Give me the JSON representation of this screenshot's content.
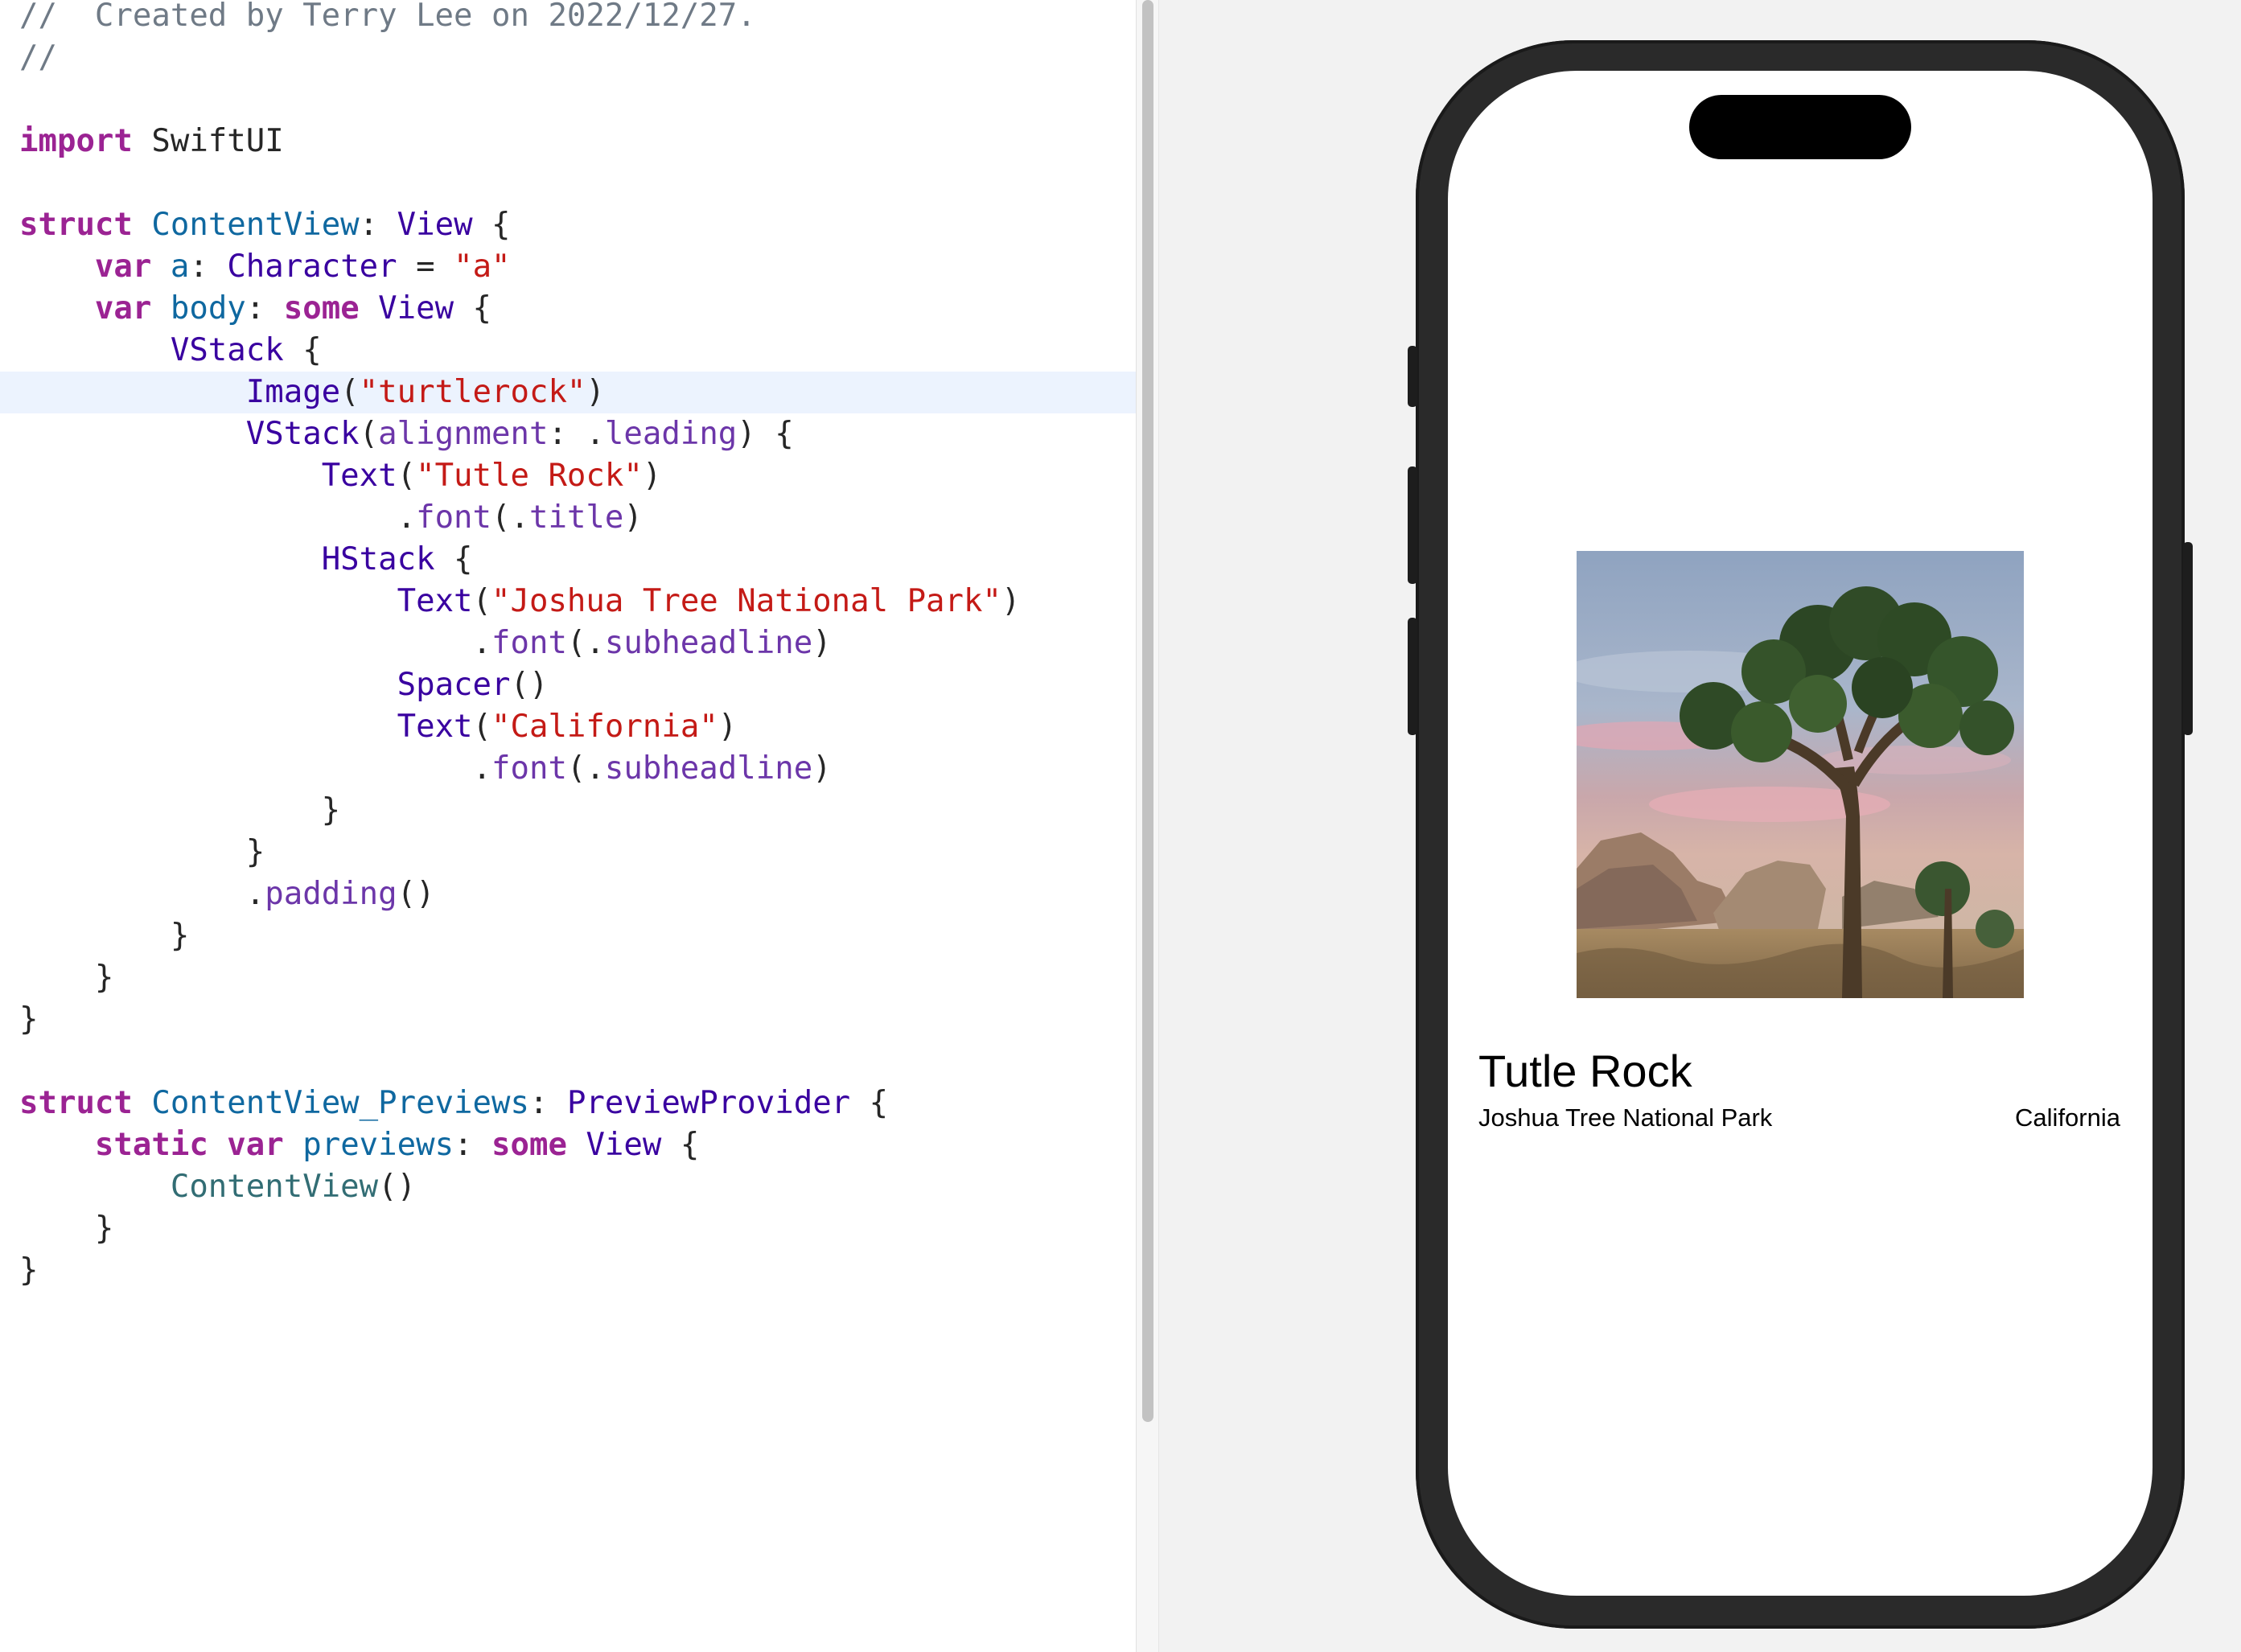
{
  "editor": {
    "lines": [
      [
        [
          "comment",
          "//  Created by Terry Lee on 2022/12/27."
        ]
      ],
      [
        [
          "comment",
          "//"
        ]
      ],
      [],
      [
        [
          "keyword",
          "import"
        ],
        [
          "plain",
          " SwiftUI"
        ]
      ],
      [],
      [
        [
          "keyword",
          "struct"
        ],
        [
          "plain",
          " "
        ],
        [
          "typedecl",
          "ContentView"
        ],
        [
          "plain",
          ": "
        ],
        [
          "type",
          "View"
        ],
        [
          "plain",
          " {"
        ]
      ],
      [
        [
          "plain",
          "    "
        ],
        [
          "keyword",
          "var"
        ],
        [
          "plain",
          " "
        ],
        [
          "typedecl",
          "a"
        ],
        [
          "plain",
          ": "
        ],
        [
          "type",
          "Character"
        ],
        [
          "plain",
          " = "
        ],
        [
          "string",
          "\"a\""
        ]
      ],
      [
        [
          "plain",
          "    "
        ],
        [
          "keyword",
          "var"
        ],
        [
          "plain",
          " "
        ],
        [
          "typedecl",
          "body"
        ],
        [
          "plain",
          ": "
        ],
        [
          "keyword",
          "some"
        ],
        [
          "plain",
          " "
        ],
        [
          "type",
          "View"
        ],
        [
          "plain",
          " {"
        ]
      ],
      [
        [
          "plain",
          "        "
        ],
        [
          "type",
          "VStack"
        ],
        [
          "plain",
          " {"
        ]
      ],
      [
        [
          "plain",
          "            "
        ],
        [
          "type",
          "Image"
        ],
        [
          "plain",
          "("
        ],
        [
          "string",
          "\"turtlerock\""
        ],
        [
          "plain",
          ")"
        ]
      ],
      [
        [
          "plain",
          "            "
        ],
        [
          "type",
          "VStack"
        ],
        [
          "plain",
          "("
        ],
        [
          "member",
          "alignment"
        ],
        [
          "plain",
          ": ."
        ],
        [
          "member",
          "leading"
        ],
        [
          "plain",
          ") {"
        ]
      ],
      [
        [
          "plain",
          "                "
        ],
        [
          "type",
          "Text"
        ],
        [
          "plain",
          "("
        ],
        [
          "string",
          "\"Tutle Rock\""
        ],
        [
          "plain",
          ")"
        ]
      ],
      [
        [
          "plain",
          "                    ."
        ],
        [
          "member",
          "font"
        ],
        [
          "plain",
          "(."
        ],
        [
          "member",
          "title"
        ],
        [
          "plain",
          ")"
        ]
      ],
      [
        [
          "plain",
          "                "
        ],
        [
          "type",
          "HStack"
        ],
        [
          "plain",
          " {"
        ]
      ],
      [
        [
          "plain",
          "                    "
        ],
        [
          "type",
          "Text"
        ],
        [
          "plain",
          "("
        ],
        [
          "string",
          "\"Joshua Tree National Park\""
        ],
        [
          "plain",
          ")"
        ]
      ],
      [
        [
          "plain",
          "                        ."
        ],
        [
          "member",
          "font"
        ],
        [
          "plain",
          "(."
        ],
        [
          "member",
          "subheadline"
        ],
        [
          "plain",
          ")"
        ]
      ],
      [
        [
          "plain",
          "                    "
        ],
        [
          "type",
          "Spacer"
        ],
        [
          "plain",
          "()"
        ]
      ],
      [
        [
          "plain",
          "                    "
        ],
        [
          "type",
          "Text"
        ],
        [
          "plain",
          "("
        ],
        [
          "string",
          "\"California\""
        ],
        [
          "plain",
          ")"
        ]
      ],
      [
        [
          "plain",
          "                        ."
        ],
        [
          "member",
          "font"
        ],
        [
          "plain",
          "(."
        ],
        [
          "member",
          "subheadline"
        ],
        [
          "plain",
          ")"
        ]
      ],
      [
        [
          "plain",
          "                }"
        ]
      ],
      [
        [
          "plain",
          "            }"
        ]
      ],
      [
        [
          "plain",
          "            ."
        ],
        [
          "member",
          "padding"
        ],
        [
          "plain",
          "()"
        ]
      ],
      [
        [
          "plain",
          "        }"
        ]
      ],
      [
        [
          "plain",
          "    }"
        ]
      ],
      [
        [
          "plain",
          "}"
        ]
      ],
      [],
      [
        [
          "keyword",
          "struct"
        ],
        [
          "plain",
          " "
        ],
        [
          "typedecl",
          "ContentView_Previews"
        ],
        [
          "plain",
          ": "
        ],
        [
          "type",
          "PreviewProvider"
        ],
        [
          "plain",
          " {"
        ]
      ],
      [
        [
          "plain",
          "    "
        ],
        [
          "keyword",
          "static"
        ],
        [
          "plain",
          " "
        ],
        [
          "keyword",
          "var"
        ],
        [
          "plain",
          " "
        ],
        [
          "typedecl",
          "previews"
        ],
        [
          "plain",
          ": "
        ],
        [
          "keyword",
          "some"
        ],
        [
          "plain",
          " "
        ],
        [
          "type",
          "View"
        ],
        [
          "plain",
          " {"
        ]
      ],
      [
        [
          "plain",
          "        "
        ],
        [
          "func",
          "ContentView"
        ],
        [
          "plain",
          "()"
        ]
      ],
      [
        [
          "plain",
          "    }"
        ]
      ],
      [
        [
          "plain",
          "}"
        ]
      ]
    ],
    "highlighted_line": 9
  },
  "preview": {
    "title": "Tutle Rock",
    "park": "Joshua Tree National Park",
    "state": "California",
    "image_name": "turtlerock"
  },
  "colors": {
    "keyword": "#9b2393",
    "type": "#3900a0",
    "typedecl": "#0f68a0",
    "string": "#c41a16",
    "member": "#6c36a9",
    "comment": "#6f7a86",
    "line_highlight": "#ecf3fe"
  }
}
